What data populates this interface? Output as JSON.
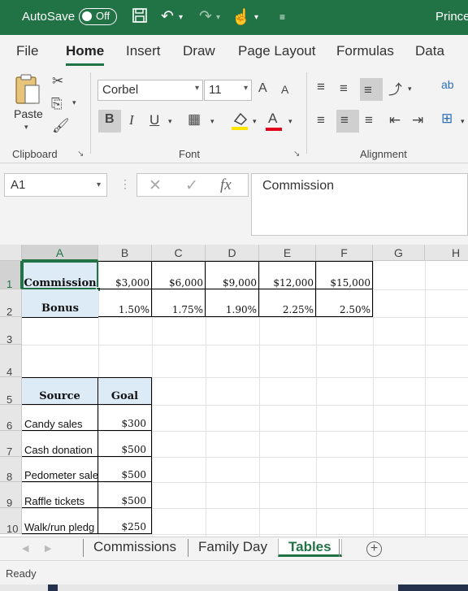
{
  "titlebar": {
    "autosave_label": "AutoSave",
    "autosave_state": "Off",
    "app_title": "Prince"
  },
  "ribbon_tabs": [
    "File",
    "Home",
    "Insert",
    "Draw",
    "Page Layout",
    "Formulas",
    "Data"
  ],
  "ribbon": {
    "paste_label": "Paste",
    "clipboard_label": "Clipboard",
    "font_label": "Font",
    "alignment_label": "Alignment",
    "font_name": "Corbel",
    "font_size": "11",
    "bold": "B",
    "italic": "I",
    "underline": "U",
    "font_color_glyph": "A",
    "grow_glyph": "A",
    "shrink_glyph": "A",
    "wrap_glyph": "ab",
    "accent_yellow": "#ffe500",
    "accent_red": "#e3001b"
  },
  "formula_bar": {
    "name_box": "A1",
    "formula": "Commission"
  },
  "columns": [
    "A",
    "B",
    "C",
    "D",
    "E",
    "F",
    "G",
    "H"
  ],
  "rows": [
    "1",
    "2",
    "3",
    "4",
    "5",
    "6",
    "7",
    "8",
    "9",
    "10"
  ],
  "table1": {
    "row1_label": "Commission",
    "row1_values": [
      "$3,000",
      "$6,000",
      "$9,000",
      "$12,000",
      "$15,000"
    ],
    "row2_label": "Bonus",
    "row2_values": [
      "1.50%",
      "1.75%",
      "1.90%",
      "2.25%",
      "2.50%"
    ],
    "label_fill": "#ddebf7"
  },
  "table2": {
    "headers": [
      "Source",
      "Goal"
    ],
    "rows": [
      {
        "source": "Candy sales",
        "goal": "$300"
      },
      {
        "source": "Cash donation",
        "goal": "$500"
      },
      {
        "source": "Pedometer sale",
        "goal": "$500"
      },
      {
        "source": "Raffle tickets",
        "goal": "$500"
      },
      {
        "source": "Walk/run pledg",
        "goal": "$250"
      }
    ]
  },
  "sheet_tabs": [
    "Commissions",
    "Family Day",
    "Tables"
  ],
  "active_sheet": "Tables",
  "status": "Ready",
  "brand_color": "#217346"
}
